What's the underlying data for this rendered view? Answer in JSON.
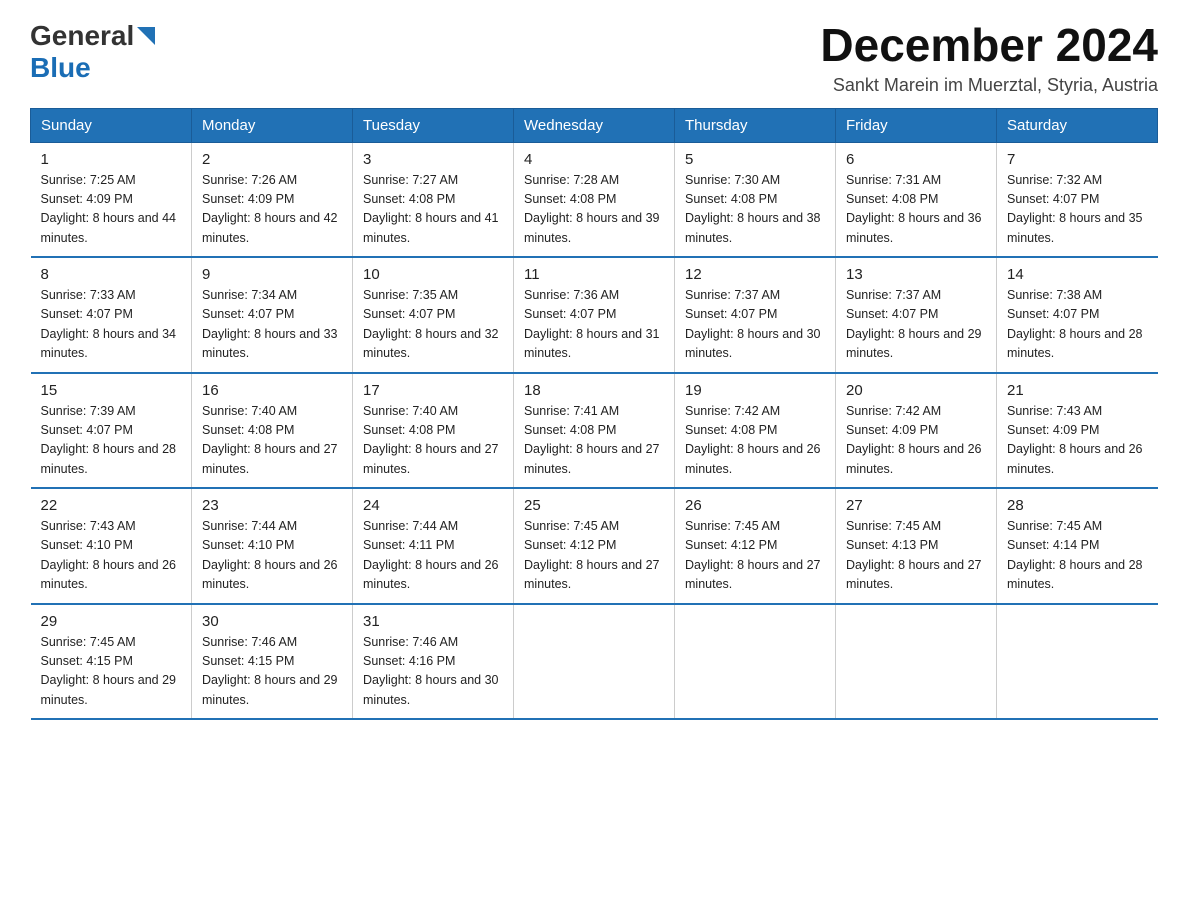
{
  "header": {
    "logo_general": "General",
    "logo_blue": "Blue",
    "month_title": "December 2024",
    "location": "Sankt Marein im Muerztal, Styria, Austria"
  },
  "days_of_week": [
    "Sunday",
    "Monday",
    "Tuesday",
    "Wednesday",
    "Thursday",
    "Friday",
    "Saturday"
  ],
  "weeks": [
    [
      {
        "day": "1",
        "sunrise": "7:25 AM",
        "sunset": "4:09 PM",
        "daylight": "8 hours and 44 minutes."
      },
      {
        "day": "2",
        "sunrise": "7:26 AM",
        "sunset": "4:09 PM",
        "daylight": "8 hours and 42 minutes."
      },
      {
        "day": "3",
        "sunrise": "7:27 AM",
        "sunset": "4:08 PM",
        "daylight": "8 hours and 41 minutes."
      },
      {
        "day": "4",
        "sunrise": "7:28 AM",
        "sunset": "4:08 PM",
        "daylight": "8 hours and 39 minutes."
      },
      {
        "day": "5",
        "sunrise": "7:30 AM",
        "sunset": "4:08 PM",
        "daylight": "8 hours and 38 minutes."
      },
      {
        "day": "6",
        "sunrise": "7:31 AM",
        "sunset": "4:08 PM",
        "daylight": "8 hours and 36 minutes."
      },
      {
        "day": "7",
        "sunrise": "7:32 AM",
        "sunset": "4:07 PM",
        "daylight": "8 hours and 35 minutes."
      }
    ],
    [
      {
        "day": "8",
        "sunrise": "7:33 AM",
        "sunset": "4:07 PM",
        "daylight": "8 hours and 34 minutes."
      },
      {
        "day": "9",
        "sunrise": "7:34 AM",
        "sunset": "4:07 PM",
        "daylight": "8 hours and 33 minutes."
      },
      {
        "day": "10",
        "sunrise": "7:35 AM",
        "sunset": "4:07 PM",
        "daylight": "8 hours and 32 minutes."
      },
      {
        "day": "11",
        "sunrise": "7:36 AM",
        "sunset": "4:07 PM",
        "daylight": "8 hours and 31 minutes."
      },
      {
        "day": "12",
        "sunrise": "7:37 AM",
        "sunset": "4:07 PM",
        "daylight": "8 hours and 30 minutes."
      },
      {
        "day": "13",
        "sunrise": "7:37 AM",
        "sunset": "4:07 PM",
        "daylight": "8 hours and 29 minutes."
      },
      {
        "day": "14",
        "sunrise": "7:38 AM",
        "sunset": "4:07 PM",
        "daylight": "8 hours and 28 minutes."
      }
    ],
    [
      {
        "day": "15",
        "sunrise": "7:39 AM",
        "sunset": "4:07 PM",
        "daylight": "8 hours and 28 minutes."
      },
      {
        "day": "16",
        "sunrise": "7:40 AM",
        "sunset": "4:08 PM",
        "daylight": "8 hours and 27 minutes."
      },
      {
        "day": "17",
        "sunrise": "7:40 AM",
        "sunset": "4:08 PM",
        "daylight": "8 hours and 27 minutes."
      },
      {
        "day": "18",
        "sunrise": "7:41 AM",
        "sunset": "4:08 PM",
        "daylight": "8 hours and 27 minutes."
      },
      {
        "day": "19",
        "sunrise": "7:42 AM",
        "sunset": "4:08 PM",
        "daylight": "8 hours and 26 minutes."
      },
      {
        "day": "20",
        "sunrise": "7:42 AM",
        "sunset": "4:09 PM",
        "daylight": "8 hours and 26 minutes."
      },
      {
        "day": "21",
        "sunrise": "7:43 AM",
        "sunset": "4:09 PM",
        "daylight": "8 hours and 26 minutes."
      }
    ],
    [
      {
        "day": "22",
        "sunrise": "7:43 AM",
        "sunset": "4:10 PM",
        "daylight": "8 hours and 26 minutes."
      },
      {
        "day": "23",
        "sunrise": "7:44 AM",
        "sunset": "4:10 PM",
        "daylight": "8 hours and 26 minutes."
      },
      {
        "day": "24",
        "sunrise": "7:44 AM",
        "sunset": "4:11 PM",
        "daylight": "8 hours and 26 minutes."
      },
      {
        "day": "25",
        "sunrise": "7:45 AM",
        "sunset": "4:12 PM",
        "daylight": "8 hours and 27 minutes."
      },
      {
        "day": "26",
        "sunrise": "7:45 AM",
        "sunset": "4:12 PM",
        "daylight": "8 hours and 27 minutes."
      },
      {
        "day": "27",
        "sunrise": "7:45 AM",
        "sunset": "4:13 PM",
        "daylight": "8 hours and 27 minutes."
      },
      {
        "day": "28",
        "sunrise": "7:45 AM",
        "sunset": "4:14 PM",
        "daylight": "8 hours and 28 minutes."
      }
    ],
    [
      {
        "day": "29",
        "sunrise": "7:45 AM",
        "sunset": "4:15 PM",
        "daylight": "8 hours and 29 minutes."
      },
      {
        "day": "30",
        "sunrise": "7:46 AM",
        "sunset": "4:15 PM",
        "daylight": "8 hours and 29 minutes."
      },
      {
        "day": "31",
        "sunrise": "7:46 AM",
        "sunset": "4:16 PM",
        "daylight": "8 hours and 30 minutes."
      },
      null,
      null,
      null,
      null
    ]
  ]
}
